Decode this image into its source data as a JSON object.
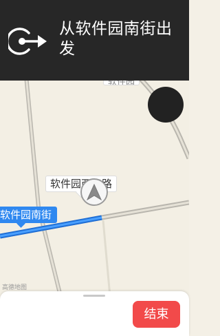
{
  "navigation": {
    "instruction": "从软件园南街出发",
    "icon": "depart-arrow-icon"
  },
  "map": {
    "street_labels": {
      "top_partial": "软件园",
      "mid": "软件园西三路",
      "current": "软件园南街"
    },
    "logo": "高德地图",
    "route_color": "#2f88f0"
  },
  "bottom_bar": {
    "end_button": "结束"
  },
  "colors": {
    "header_bg": "#272727",
    "end_button": "#f24a4a"
  }
}
